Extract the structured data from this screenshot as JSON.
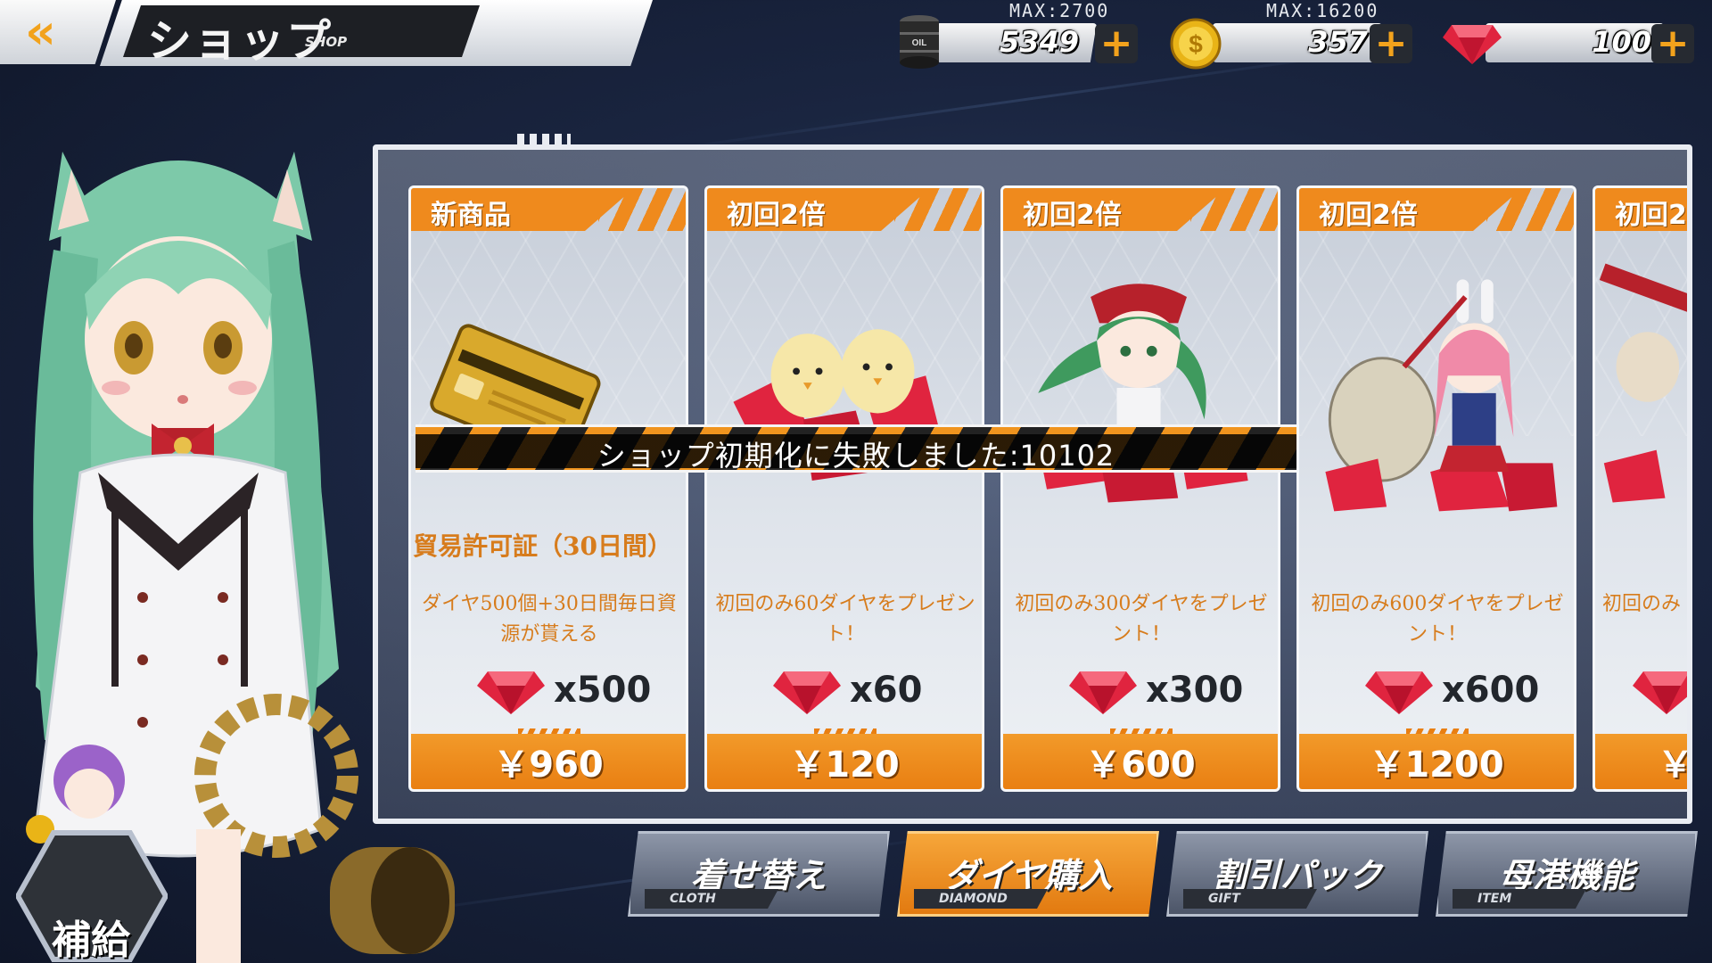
{
  "header": {
    "back_icon": "double-chevron-left-icon",
    "title": "ショップ",
    "subtitle": "SHOP"
  },
  "resources": [
    {
      "name": "oil",
      "icon": "oil-barrel-icon",
      "max_label": "MAX:2700",
      "value": "5349"
    },
    {
      "name": "gold",
      "icon": "gold-coin-icon",
      "max_label": "MAX:16200",
      "value": "357"
    },
    {
      "name": "diamond",
      "icon": "red-diamond-icon",
      "max_label": "",
      "value": "100"
    }
  ],
  "cards": [
    {
      "tag": "新商品",
      "name": "貿易許可証（30日間）",
      "desc": "ダイヤ500個+30日間毎日資源が貰える",
      "qty": "x500",
      "price": "￥960"
    },
    {
      "tag": "初回2倍",
      "name": "",
      "desc": "初回のみ60ダイヤをプレゼント！",
      "qty": "x60",
      "price": "￥120"
    },
    {
      "tag": "初回2倍",
      "name": "",
      "desc": "初回のみ300ダイヤをプレゼント！",
      "qty": "x300",
      "price": "￥600"
    },
    {
      "tag": "初回2倍",
      "name": "",
      "desc": "初回のみ600ダイヤをプレゼント！",
      "qty": "x600",
      "price": "￥1200"
    },
    {
      "tag": "初回2",
      "name": "",
      "desc": "初回のみ",
      "qty": "",
      "price": "￥"
    }
  ],
  "toast": {
    "message": "ショップ初期化に失敗しました:10102"
  },
  "tabs": [
    {
      "label": "着せ替え",
      "sub": "CLOTH",
      "active": false
    },
    {
      "label": "ダイヤ購入",
      "sub": "DIAMOND",
      "active": true
    },
    {
      "label": "割引パック",
      "sub": "GIFT",
      "active": false
    },
    {
      "label": "母港機能",
      "sub": "ITEM",
      "active": false
    }
  ],
  "supply": {
    "label": "補給"
  },
  "colors": {
    "accent_orange": "#ef8a1d",
    "panel_border": "#e9ecf2",
    "diamond_red": "#e0243f"
  }
}
